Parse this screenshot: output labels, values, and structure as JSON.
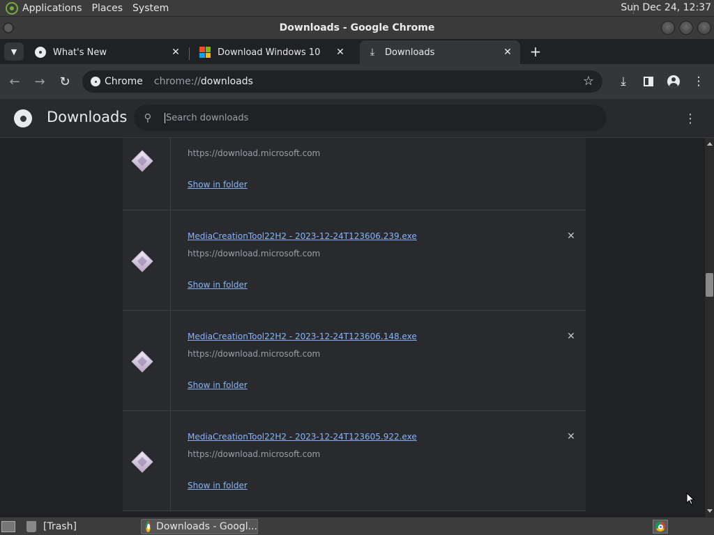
{
  "top_panel": {
    "menus": [
      "Applications",
      "Places",
      "System"
    ],
    "clock": "Sun Dec 24, 12:37"
  },
  "window": {
    "title": "Downloads - Google Chrome"
  },
  "tabs": [
    {
      "label": "What's New",
      "icon": "chrome-icon",
      "active": false
    },
    {
      "label": "Download Windows 10",
      "icon": "windows-logo-icon",
      "active": false
    },
    {
      "label": "Downloads",
      "icon": "download-icon",
      "active": true
    }
  ],
  "toolbar": {
    "omnibox_chip": "Chrome",
    "url_scheme": "chrome://",
    "url_host": "downloads"
  },
  "downloads_page": {
    "title": "Downloads",
    "search_placeholder": "Search downloads",
    "items": [
      {
        "file_name": "",
        "source": "https://download.microsoft.com",
        "action": "Show in folder"
      },
      {
        "file_name": "MediaCreationTool22H2 - 2023-12-24T123606.239.exe",
        "source": "https://download.microsoft.com",
        "action": "Show in folder"
      },
      {
        "file_name": "MediaCreationTool22H2 - 2023-12-24T123606.148.exe",
        "source": "https://download.microsoft.com",
        "action": "Show in folder"
      },
      {
        "file_name": "MediaCreationTool22H2 - 2023-12-24T123605.922.exe",
        "source": "https://download.microsoft.com",
        "action": "Show in folder"
      }
    ]
  },
  "taskbar": {
    "tasks": [
      {
        "label": "[Trash]",
        "active": false
      },
      {
        "label": "Downloads - Googl...",
        "active": true
      }
    ]
  }
}
